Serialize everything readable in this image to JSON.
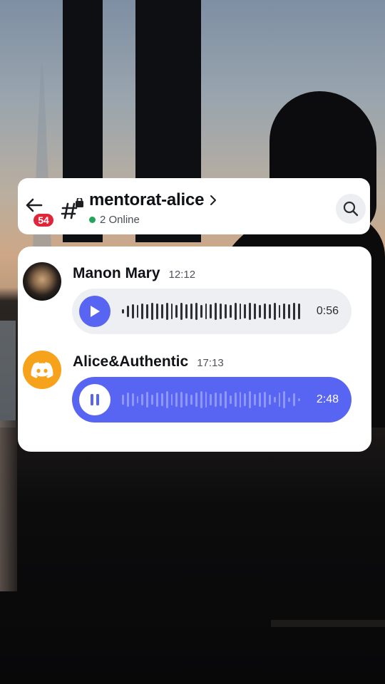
{
  "header": {
    "unread_count": "54",
    "channel_name": "mentorat-alice",
    "online_status": "2 Online",
    "online_color": "#23a55a"
  },
  "messages": [
    {
      "author": "Manon Mary",
      "time": "12:12",
      "avatar": "user-photo",
      "voice": {
        "state": "paused",
        "duration": "0:56",
        "control_icon": "play-icon"
      }
    },
    {
      "author": "Alice&Authentic",
      "time": "17:13",
      "avatar": "discord-logo",
      "voice": {
        "state": "playing",
        "duration": "2:48",
        "control_icon": "pause-icon"
      }
    }
  ],
  "colors": {
    "accent": "#5865f2",
    "badge": "#e0243a",
    "discord_avatar_bg": "#f7a21b"
  }
}
